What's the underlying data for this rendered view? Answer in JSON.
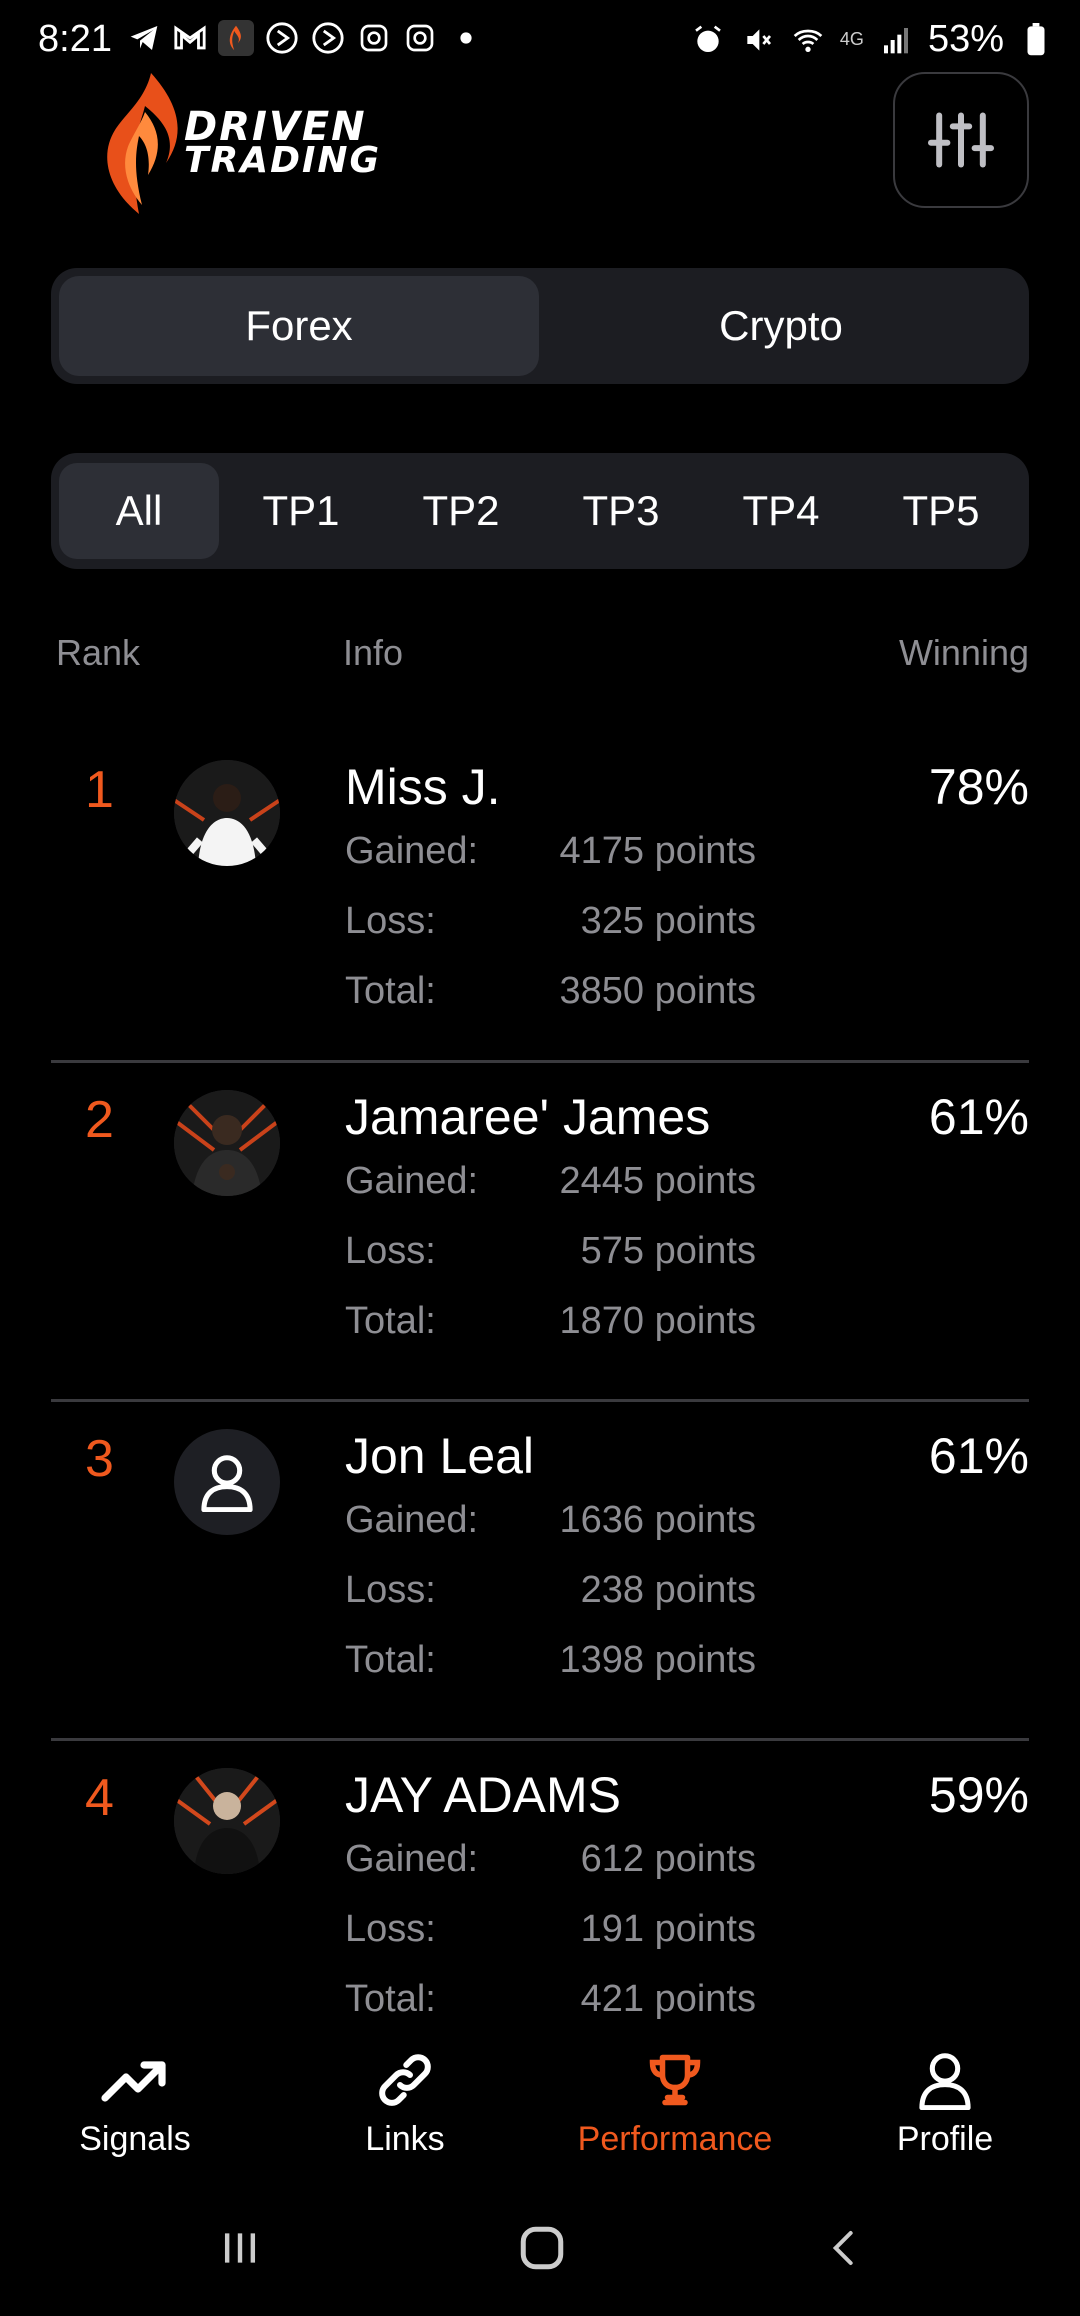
{
  "status_bar": {
    "time": "8:21",
    "battery": "53%",
    "network": "4G",
    "left_icons": [
      "telegram-icon",
      "gmail-icon",
      "driven-app-icon",
      "play-icon",
      "play-icon",
      "instagram-icon",
      "instagram-icon",
      "dot-icon"
    ],
    "right_icons": [
      "alarm-icon",
      "mute-icon",
      "wifi-icon",
      "signal-icon",
      "battery-icon"
    ]
  },
  "header": {
    "logo_line1": "DRIVEN",
    "logo_line2": "TRADING"
  },
  "market_tabs": [
    {
      "label": "Forex",
      "active": true
    },
    {
      "label": "Crypto",
      "active": false
    }
  ],
  "tp_tabs": [
    {
      "label": "All",
      "active": true
    },
    {
      "label": "TP1",
      "active": false
    },
    {
      "label": "TP2",
      "active": false
    },
    {
      "label": "TP3",
      "active": false
    },
    {
      "label": "TP4",
      "active": false
    },
    {
      "label": "TP5",
      "active": false
    }
  ],
  "columns": {
    "rank": "Rank",
    "info": "Info",
    "winning": "Winning"
  },
  "labels": {
    "gained": "Gained:",
    "loss": "Loss:",
    "total": "Total:"
  },
  "rows": [
    {
      "rank": "1",
      "name": "Miss J.",
      "winning": "78%",
      "gained": "4175 points",
      "loss": "325 points",
      "total": "3850 points",
      "avatar": "photo"
    },
    {
      "rank": "2",
      "name": "Jamaree' James",
      "winning": "61%",
      "gained": "2445 points",
      "loss": "575 points",
      "total": "1870 points",
      "avatar": "photo"
    },
    {
      "rank": "3",
      "name": "Jon Leal",
      "winning": "61%",
      "gained": "1636 points",
      "loss": "238 points",
      "total": "1398 points",
      "avatar": "user-placeholder-icon"
    },
    {
      "rank": "4",
      "name": "JAY ADAMS",
      "winning": "59%",
      "gained": "612 points",
      "loss": "191 points",
      "total": "421 points",
      "avatar": "photo"
    }
  ],
  "bottom_nav": [
    {
      "label": "Signals",
      "icon": "trending-up-icon",
      "active": false
    },
    {
      "label": "Links",
      "icon": "link-icon",
      "active": false
    },
    {
      "label": "Performance",
      "icon": "trophy-icon",
      "active": true
    },
    {
      "label": "Profile",
      "icon": "user-icon",
      "active": false
    }
  ],
  "colors": {
    "accent": "#f0591e",
    "background": "#000000",
    "panel": "#1c1d22",
    "muted": "#8e8e93"
  }
}
